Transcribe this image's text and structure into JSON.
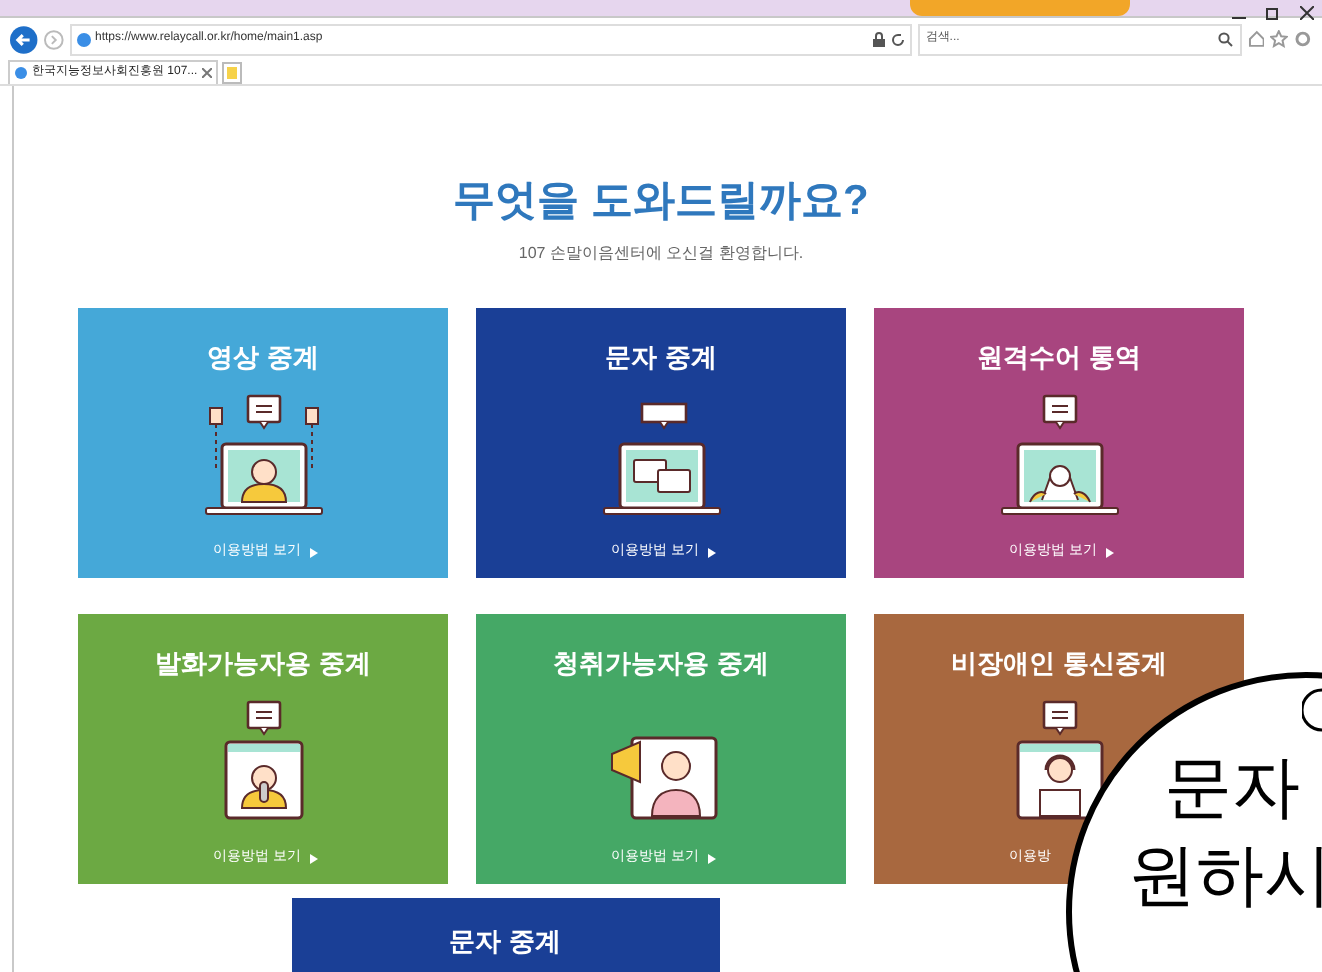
{
  "browser": {
    "url": "https://www.relaycall.or.kr/home/main1.asp",
    "search_placeholder": "검색...",
    "tabs": [
      {
        "label": "한국지능정보사회진흥원 107...",
        "selected": true
      }
    ]
  },
  "page": {
    "heading": "무엇을 도와드릴까요?",
    "subheading": "107 손말이음센터에 오신걸 환영합니다.",
    "services": [
      {
        "title": "영상 중계",
        "link": "이용방법 보기",
        "arrow": true,
        "color": "#45a8d8",
        "kind": "video"
      },
      {
        "title": "문자 중계",
        "link": "이용방법 보기",
        "arrow": true,
        "color": "#1a3f96",
        "kind": "text"
      },
      {
        "title": "원격수어 통역",
        "link": "이용방법 보기",
        "arrow": true,
        "color": "#a8457f",
        "kind": "sign"
      },
      {
        "title": "발화가능자용 중계",
        "link": "이용방법 보기",
        "arrow": true,
        "color": "#6ca943",
        "kind": "speech"
      },
      {
        "title": "청취가능자용 중계",
        "link": "이용방법 보기",
        "arrow": true,
        "color": "#45a866",
        "kind": "hearing"
      },
      {
        "title": "비장애인 통신중계",
        "link": "이용방",
        "arrow": false,
        "color": "#a8683f",
        "kind": "operator"
      }
    ],
    "partial_card": {
      "title": "문자 중계",
      "color": "#1a3f96"
    }
  },
  "overlay": {
    "lines": [
      "문자",
      "원하시"
    ]
  }
}
